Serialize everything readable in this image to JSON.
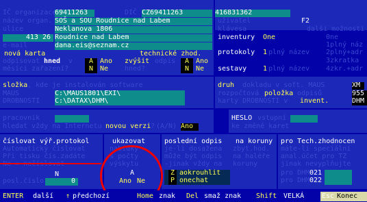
{
  "company": {
    "ic_label": "IČ organizace",
    "ic_value": "69411263",
    "dic_label": "DIČ",
    "dic_value": "CZ69411263",
    "reg_label": "",
    "reg_value": "416831362",
    "nazev_label": "název organ.",
    "name1": "SOŠ a SOU Roudnice nad Labem",
    "ulice_label": "ulice",
    "street": "Neklanova 1806",
    "psc_label": "PSČ obec",
    "zip": "413 26",
    "city": "Roudnice nad Labem",
    "email_label": "e-mail",
    "email": "dana.eis@seznam.cz"
  },
  "right_top": {
    "uzivatel_label": "uživatel",
    "key_label": "klávesa",
    "key_value": "F2",
    "moznosti_label": "další možnosti",
    "inventury_label": "inventury",
    "inventury_val": "One",
    "protokoly_label": "protokoly",
    "protokoly_num": "1",
    "protokoly_text": "plný název",
    "sestavy_label": "sestavy",
    "sestavy_num": "1",
    "sestavy_text": "plný název",
    "opt_list": [
      "0ne",
      "1plný náz",
      "2plný+adr",
      "3zkratka",
      "4zkr.+adr"
    ]
  },
  "card": {
    "nova_karta": "nová karta",
    "odpisovat_text": "odpisovat",
    "hned": "hned",
    "v_label": "v",
    "ano1": "Ano",
    "mesici_text": "měsíci zařazení?",
    "ne1": "Ne",
    "tech_zhod": "technické zhod.",
    "zvysit": "zvýšit",
    "odpis_text": "odpis",
    "ano2": "Ano",
    "hned2": "hned?",
    "ne2": "Ne",
    "A_key": "A",
    "N_key": "N"
  },
  "paths": {
    "slozka_label": "složka",
    "slozka_rest": ", kde je instalován software",
    "maus_label": "MAUS",
    "maus_path": "C:\\MAUS1801\\EXI\\",
    "drob_label": "DROBNOSTI",
    "drob_path": "C:\\DATAX\\DHM\\",
    "druh_label": "druh",
    "druh_rest": " dokladu v soft. MAUS",
    "druh_val": "XM",
    "rozp_text": "rozpočtová",
    "polozka": "položka",
    "odpisu_text": "odpisů",
    "odpisu_val": "955",
    "karty_text": "karty DROBNOSTI v",
    "invent": "invent.",
    "dhm": "DHM"
  },
  "update": {
    "pracovnik_label": "pracovník",
    "hledat_text": "hledat vždy na Internetu",
    "novou_verzi": "novou verzi",
    "verzi_q": "?",
    "an": "(A/N)",
    "ano": "Ano",
    "heslo_label": "HESLO",
    "vstupni": "vstupní",
    "zmene_text": "ke změně karet"
  },
  "protocol": {
    "cislovat_label": "číslovat výř.protokol",
    "auto_text": "Automatický číslovat",
    "pri_text": "Při tisku čís.zadáte",
    "ne_text": "Ne = nečíslovat",
    "n_value": "N",
    "posl_label": "posl.číslo",
    "posl_value": "0",
    "ukazovat_label": "ukazovat",
    "nabidky": "nabídky",
    "s_poctu": "s počty",
    "vyskytu": "výskytu",
    "a_val": "A",
    "ano": "Ano",
    "ne": "Ne",
    "posledni_label": "poslední odpis",
    "je_li": "je-li dosažena",
    "muze_text": "může být odpis",
    "jinak_text": "-jinak vždy na",
    "zaokr_z": "Z",
    "zaokr": "aokrouhlit",
    "ponechat_p": "P",
    "ponechat": "onechat",
    "na_koruny": "na koruny",
    "zbyt_hod": "zbyt.hod.",
    "na_halire": "na haléře",
    "koruny": "koruny",
    "pro_tech": "pro Tech.zhodnocen",
    "mate_li": "máte-li speciální",
    "anal": "anal.účet pro TZ",
    "jinak_nev": "jinak nevyplňujte",
    "pro_dhm1": "pro DHM",
    "val1": "021",
    "pro_dhm2": "pro DHM",
    "val2": "022"
  },
  "footer": {
    "enter": "ENTER",
    "dalsi": "další",
    "arrow": "↑",
    "predchozi": "předchozí",
    "home": "Home",
    "znak1": "znak",
    "del": "Del",
    "smaz": "smaž znak",
    "shift": "Shift",
    "velka": "VELKÁ",
    "esc": "Esc",
    "konec": "Konec"
  }
}
